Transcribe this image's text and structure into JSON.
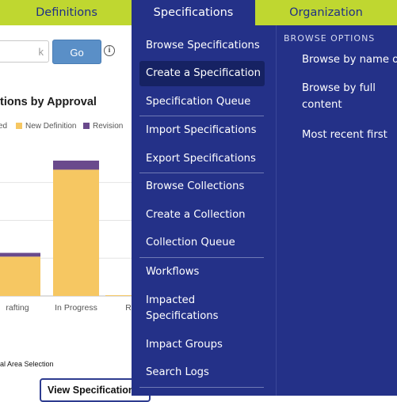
{
  "nav": {
    "tabs": [
      "Definitions",
      "Specifications",
      "Organization"
    ],
    "active_tab": "Specifications",
    "colors": {
      "bar": "#bfd730",
      "active": "#243188",
      "text": "#1f2f86"
    }
  },
  "page": {
    "search_value": "k",
    "go_label": "Go",
    "info_icon": "i",
    "chart_title": "tions by Approval",
    "footer_text": "al Area Selection",
    "view_button_label": "View Specification"
  },
  "chart_data": {
    "type": "bar",
    "title": "tions by Approval",
    "categories": [
      "rafting",
      "In Progress",
      "R"
    ],
    "series": [
      {
        "name": "ed",
        "color": "#ffffff",
        "values": [
          0,
          0,
          0
        ]
      },
      {
        "name": "New Definition",
        "color": "#f6c762",
        "values": [
          52,
          167,
          1
        ]
      },
      {
        "name": "Revision",
        "color": "#6a4a8c",
        "values": [
          5,
          12,
          0
        ]
      }
    ],
    "ylim": [
      0,
      180
    ],
    "grid": true,
    "legend": "top"
  },
  "menu": {
    "items": [
      "Browse Specifications",
      "Create a Specification",
      "Specification Queue",
      "Import Specifications",
      "Export Specifications",
      "Browse Collections",
      "Create a Collection",
      "Collection Queue",
      "Workflows",
      "Impacted Specifications",
      "Impact Groups",
      "Search Logs"
    ],
    "active_item": "Create a Specification",
    "browse_header": "BROWSE OPTIONS",
    "browse_options": [
      "Browse by name or",
      "Browse by full content",
      "Most recent first"
    ],
    "colors": {
      "background": "#243188",
      "active": "#162263"
    }
  }
}
